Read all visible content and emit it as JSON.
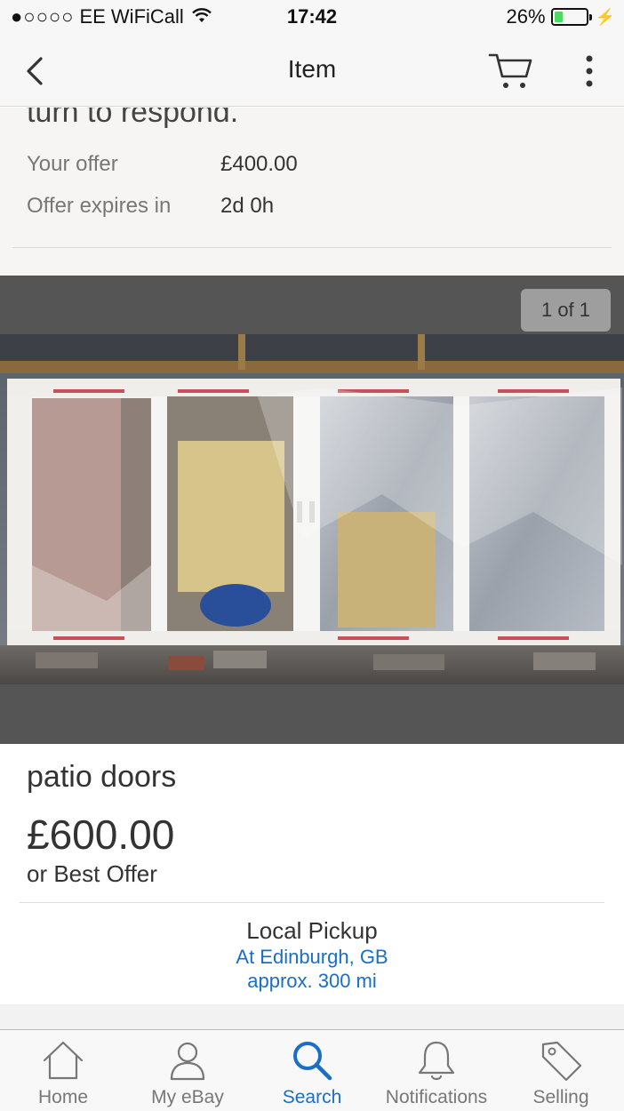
{
  "status_bar": {
    "signal": "●○○○○",
    "carrier": "EE WiFiCall",
    "time": "17:42",
    "battery_percent": "26%",
    "battery_level": 0.26
  },
  "nav": {
    "title": "Item",
    "icons": [
      "chevron-left-icon",
      "cart-icon",
      "more-vertical-icon"
    ]
  },
  "offer": {
    "cut_text": "turn to respond.",
    "your_offer_label": "Your offer",
    "your_offer_value": "£400.00",
    "expires_label": "Offer expires in",
    "expires_value": "2d 0h"
  },
  "gallery": {
    "counter": "1 of 1"
  },
  "item": {
    "title": "patio doors",
    "price": "£600.00",
    "best_offer": "or Best Offer"
  },
  "pickup": {
    "title": "Local Pickup",
    "location": "At Edinburgh, GB",
    "distance": "approx. 300 mi"
  },
  "tabs": [
    {
      "label": "Home",
      "icon": "home-icon",
      "active": false
    },
    {
      "label": "My eBay",
      "icon": "person-icon",
      "active": false
    },
    {
      "label": "Search",
      "icon": "search-icon",
      "active": true
    },
    {
      "label": "Notifications",
      "icon": "bell-icon",
      "active": false
    },
    {
      "label": "Selling",
      "icon": "tag-icon",
      "active": false
    }
  ],
  "colors": {
    "accent_blue": "#1a6ec8",
    "battery_green": "#4cd964",
    "gallery_bg": "#555555"
  }
}
